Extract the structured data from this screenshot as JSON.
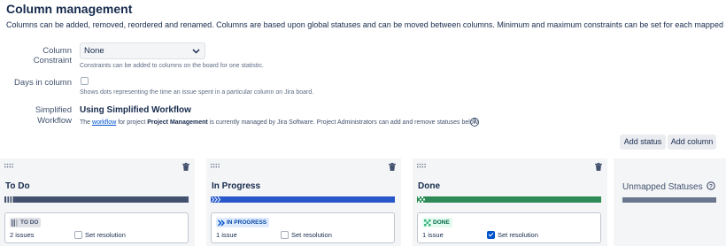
{
  "page": {
    "title": "Column management",
    "description": "Columns can be added, removed, reordered and renamed. Columns are based upon global statuses and can be moved between columns. Minimum and maximum constraints can be set for each mapped column."
  },
  "settings": {
    "constraint_label": "Column Constraint",
    "constraint_value": "None",
    "constraint_help": "Constraints can be added to columns on the board for one statistic.",
    "days_label": "Days in column",
    "days_checked": false,
    "days_help": "Shows dots representing the time an issue spent in a particular column on Jira board.",
    "workflow_label_1": "Simplified",
    "workflow_label_2": "Workflow",
    "workflow_title": "Using Simplified Workflow",
    "workflow_text_1": "The ",
    "workflow_link": "workflow",
    "workflow_text_2": " for project ",
    "workflow_project": "Project Management",
    "workflow_text_3": " is currently managed by Jira Software. Project Administrators can add and remove statuses below."
  },
  "toolbar": {
    "add_status": "Add status",
    "add_column": "Add column"
  },
  "columns": [
    {
      "name": "To Do",
      "status": "TO DO",
      "issues": "2 issues",
      "set_resolution": "Set resolution",
      "resolution_checked": false,
      "colors": {
        "bar": "#42526e",
        "lozenge_bg": "#dfe1e6",
        "lozenge_text": "#42526e"
      }
    },
    {
      "name": "In Progress",
      "status": "IN PROGRESS",
      "issues": "1 issue",
      "set_resolution": "Set resolution",
      "resolution_checked": false,
      "colors": {
        "bar": "#2757c8",
        "lozenge_bg": "#deebff",
        "lozenge_text": "#0747a6"
      }
    },
    {
      "name": "Done",
      "status": "DONE",
      "issues": "1 issue",
      "set_resolution": "Set resolution",
      "resolution_checked": true,
      "colors": {
        "bar": "#2e8b57",
        "lozenge_bg": "#e3fcef",
        "lozenge_text": "#006644"
      }
    }
  ],
  "unmapped": {
    "title": "Unmapped Statuses"
  },
  "icons": {
    "drag": "drag-handle-icon",
    "trash": "trash-icon",
    "help": "question-circle-icon",
    "chevron": "chevron-down-icon"
  }
}
